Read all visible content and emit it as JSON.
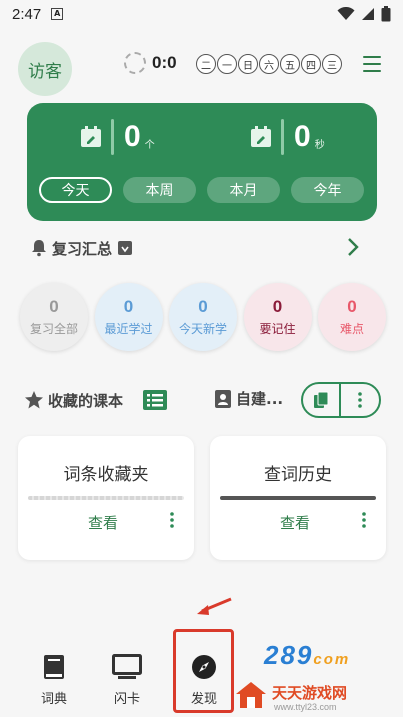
{
  "status_bar": {
    "time": "2:47",
    "a_icon": "A"
  },
  "header": {
    "avatar_label": "访客",
    "streak_score": "0:0",
    "weekdays": [
      "二",
      "一",
      "日",
      "六",
      "五",
      "四",
      "三"
    ]
  },
  "stats": {
    "count_value": "0",
    "count_unit": "个",
    "time_value": "0",
    "time_unit": "秒",
    "periods": [
      "今天",
      "本周",
      "本月",
      "今年"
    ],
    "active_period": "今天"
  },
  "review": {
    "title": "复习汇总",
    "buttons": [
      {
        "count": "0",
        "label": "复习全部",
        "bg": "#eeeeee",
        "color": "#999999"
      },
      {
        "count": "0",
        "label": "最近学过",
        "bg": "#e3eff8",
        "color": "#5b9bd5"
      },
      {
        "count": "0",
        "label": "今天新学",
        "bg": "#e3eff8",
        "color": "#5b9bd5"
      },
      {
        "count": "0",
        "label": "要记住",
        "bg": "#f8e6ea",
        "color": "#8b1c3a"
      },
      {
        "count": "0",
        "label": "难点",
        "bg": "#f8e6ea",
        "color": "#e8586a"
      }
    ]
  },
  "courses": {
    "favorites_label": "收藏的课本",
    "self_built_label": "自建..."
  },
  "cards": [
    {
      "title": "词条收藏夹",
      "action": "查看",
      "divider_color": "#d6d6d6"
    },
    {
      "title": "查词历史",
      "action": "查看",
      "divider_color": "#555555"
    }
  ],
  "nav": {
    "items": [
      {
        "label": "词典",
        "icon": "book-icon"
      },
      {
        "label": "闪卡",
        "icon": "monitor-icon"
      },
      {
        "label": "发现",
        "icon": "compass-icon"
      }
    ]
  },
  "watermark": {
    "logo": "289",
    "logo_suffix": "com",
    "name": "天天游戏网",
    "url": "www.ttyl23.com"
  },
  "colors": {
    "primary": "#2e8b57",
    "highlight": "#d93a2b"
  }
}
